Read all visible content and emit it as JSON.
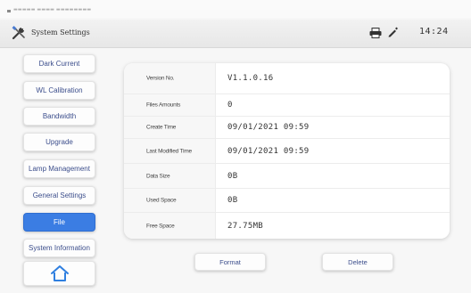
{
  "window": {
    "title": "System Settings",
    "clock": "14:24"
  },
  "sidebar": {
    "items": [
      {
        "label": "Dark Current",
        "active": false
      },
      {
        "label": "WL Calibration",
        "active": false
      },
      {
        "label": "Bandwidth",
        "active": false
      },
      {
        "label": "Upgrade",
        "active": false
      },
      {
        "label": "Lamp Management",
        "active": false
      },
      {
        "label": "General Settings",
        "active": false
      },
      {
        "label": "File",
        "active": true
      },
      {
        "label": "System Information",
        "active": false
      }
    ],
    "home_icon": "home-icon"
  },
  "info": {
    "rows": [
      {
        "label": "Version No.",
        "value": "V1.1.0.16"
      },
      {
        "label": "Files Amounts",
        "value": "0"
      },
      {
        "label": "Create Time",
        "value": "09/01/2021 09:59"
      },
      {
        "label": "Last Modified Time",
        "value": "09/01/2021 09:59"
      },
      {
        "label": "Data Size",
        "value": "0B"
      },
      {
        "label": "Used Space",
        "value": "0B"
      },
      {
        "label": "Free Space",
        "value": "27.75MB"
      }
    ]
  },
  "actions": {
    "format_label": "Format",
    "delete_label": "Delete"
  },
  "colors": {
    "accent": "#3b7de3",
    "button_text": "#3c4e8c",
    "active_text": "#ffffff"
  }
}
